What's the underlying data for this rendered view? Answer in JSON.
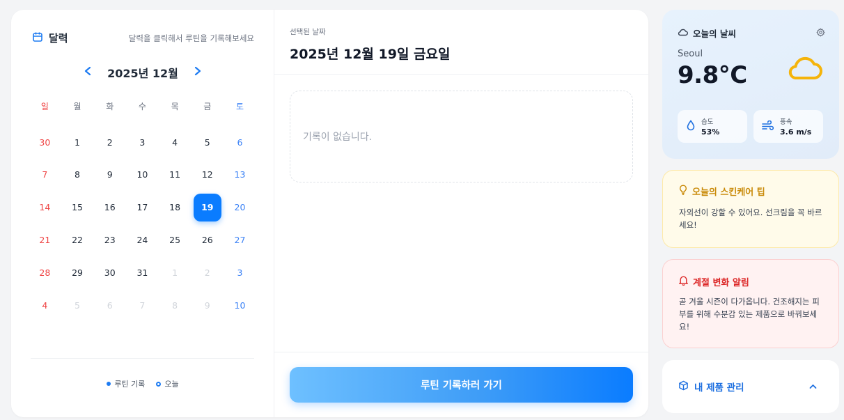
{
  "calendar": {
    "title": "달력",
    "hint": "달력을 클릭해서 루틴을 기록해보세요",
    "month_label": "2025년 12월",
    "weekdays": [
      "일",
      "월",
      "화",
      "수",
      "목",
      "금",
      "토"
    ],
    "weeks": [
      [
        "30",
        "1",
        "2",
        "3",
        "4",
        "5",
        "6"
      ],
      [
        "7",
        "8",
        "9",
        "10",
        "11",
        "12",
        "13"
      ],
      [
        "14",
        "15",
        "16",
        "17",
        "18",
        "19",
        "20"
      ],
      [
        "21",
        "22",
        "23",
        "24",
        "25",
        "26",
        "27"
      ],
      [
        "28",
        "29",
        "30",
        "31",
        "1",
        "2",
        "3"
      ],
      [
        "4",
        "5",
        "6",
        "7",
        "8",
        "9",
        "10"
      ]
    ],
    "selected_day": "19",
    "legend": {
      "routine": "루틴 기록",
      "today": "오늘"
    }
  },
  "record": {
    "sub_label": "선택된 날짜",
    "selected_date": "2025년 12월 19일 금요일",
    "empty_text": "기록이 없습니다.",
    "cta_label": "루틴 기록하러 가기"
  },
  "weather": {
    "title": "오늘의 날씨",
    "city": "Seoul",
    "temperature": "9.8°C",
    "humidity_label": "습도",
    "humidity_value": "53%",
    "wind_label": "풍속",
    "wind_value": "3.6 m/s"
  },
  "tip": {
    "title": "오늘의 스킨케어 팁",
    "body": "자외선이 강할 수 있어요. 선크림을 꼭 바르세요!"
  },
  "alert": {
    "title": "계절 변화 알림",
    "body": "곧 겨울 시즌이 다가옵니다. 건조해지는 피부를 위해 수분감 있는 제품으로 바꿔보세요!"
  },
  "products": {
    "title": "내 제품 관리"
  },
  "colors": {
    "accent": "#0a7cff",
    "sunday": "#ef4444",
    "saturday": "#3b82f6",
    "tip": "#c98a08",
    "alert": "#dc2626"
  }
}
